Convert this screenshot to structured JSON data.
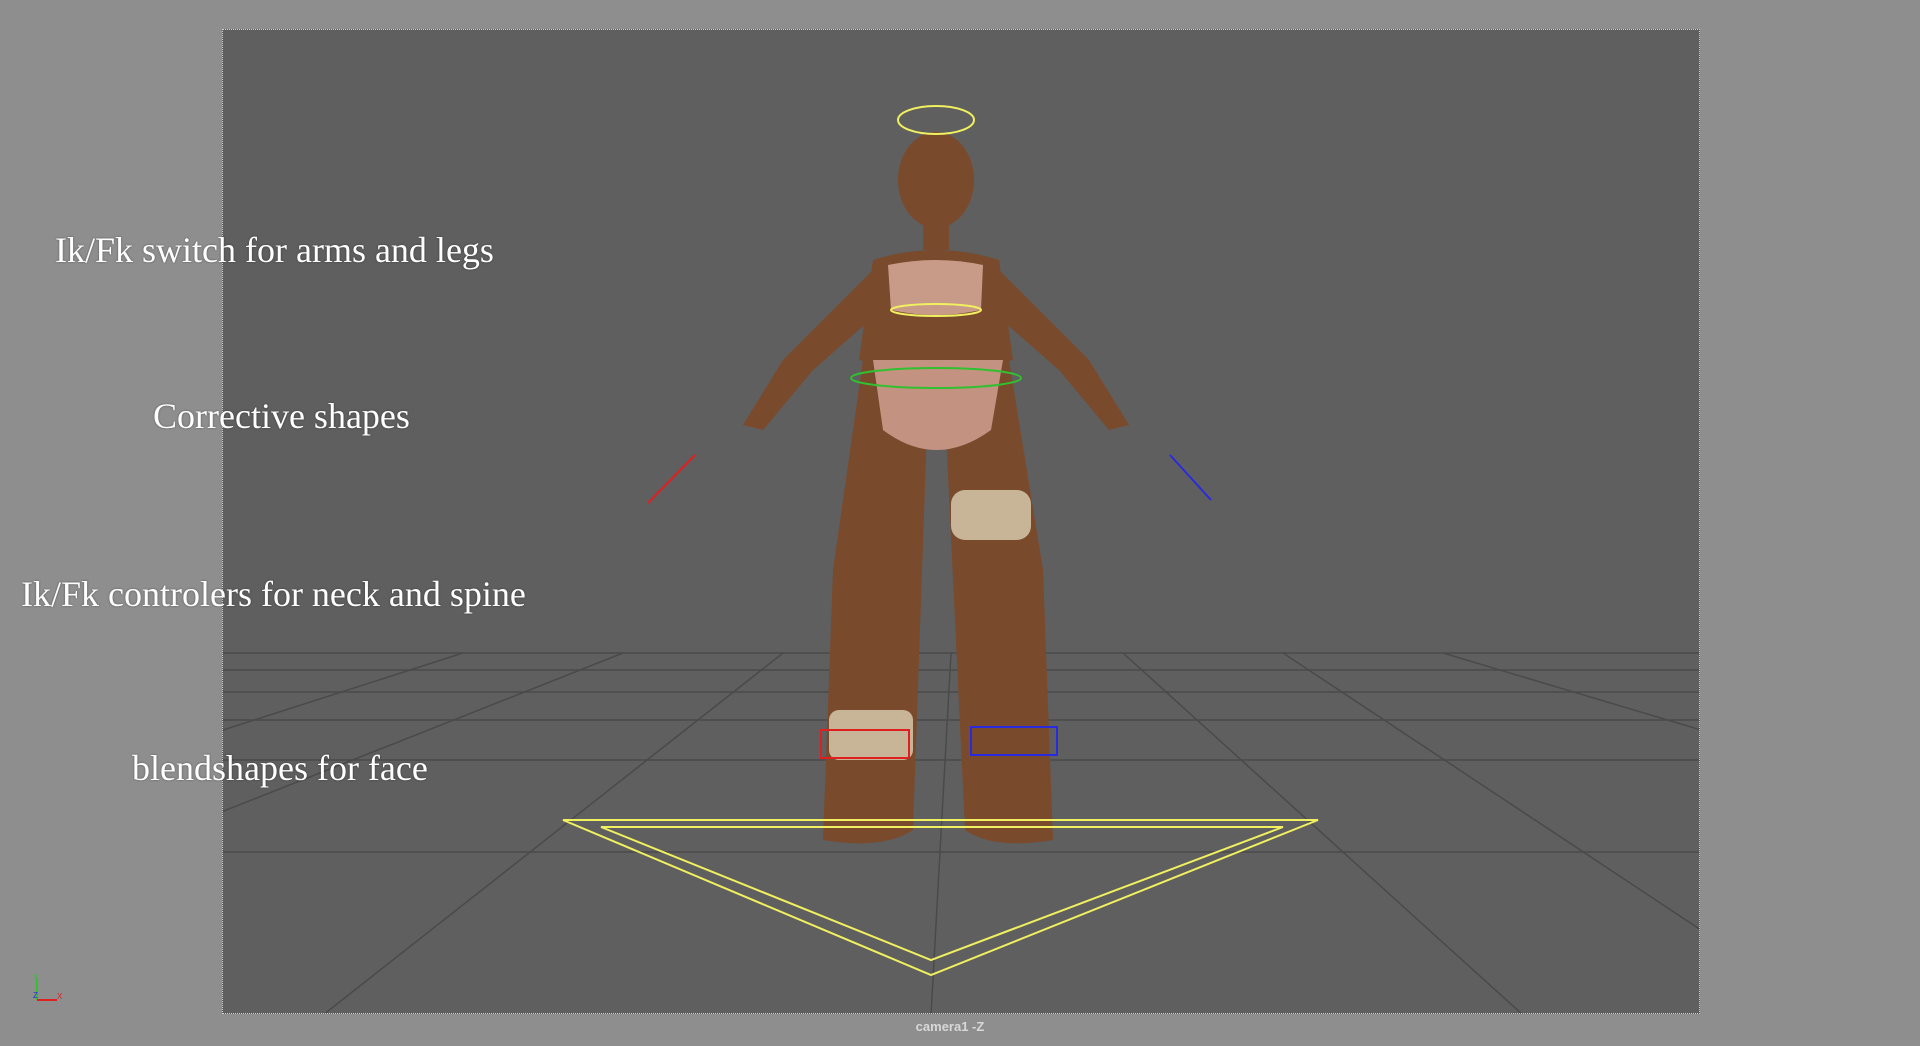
{
  "captions": [
    "Ik/Fk switch for arms and legs",
    "Corrective shapes",
    "Ik/Fk controlers for neck and spine",
    "blendshapes for face"
  ],
  "viewport": {
    "camera_label": "camera1 -Z",
    "axis_labels": {
      "y": "Y",
      "z": "Z",
      "x": "X"
    }
  },
  "colors": {
    "background": "#8e8e8e",
    "viewport": "#5f5f5f",
    "control_yellow": "#f0f060",
    "control_red": "#e02020",
    "control_blue": "#2a2ae0",
    "control_green": "#30c030"
  }
}
